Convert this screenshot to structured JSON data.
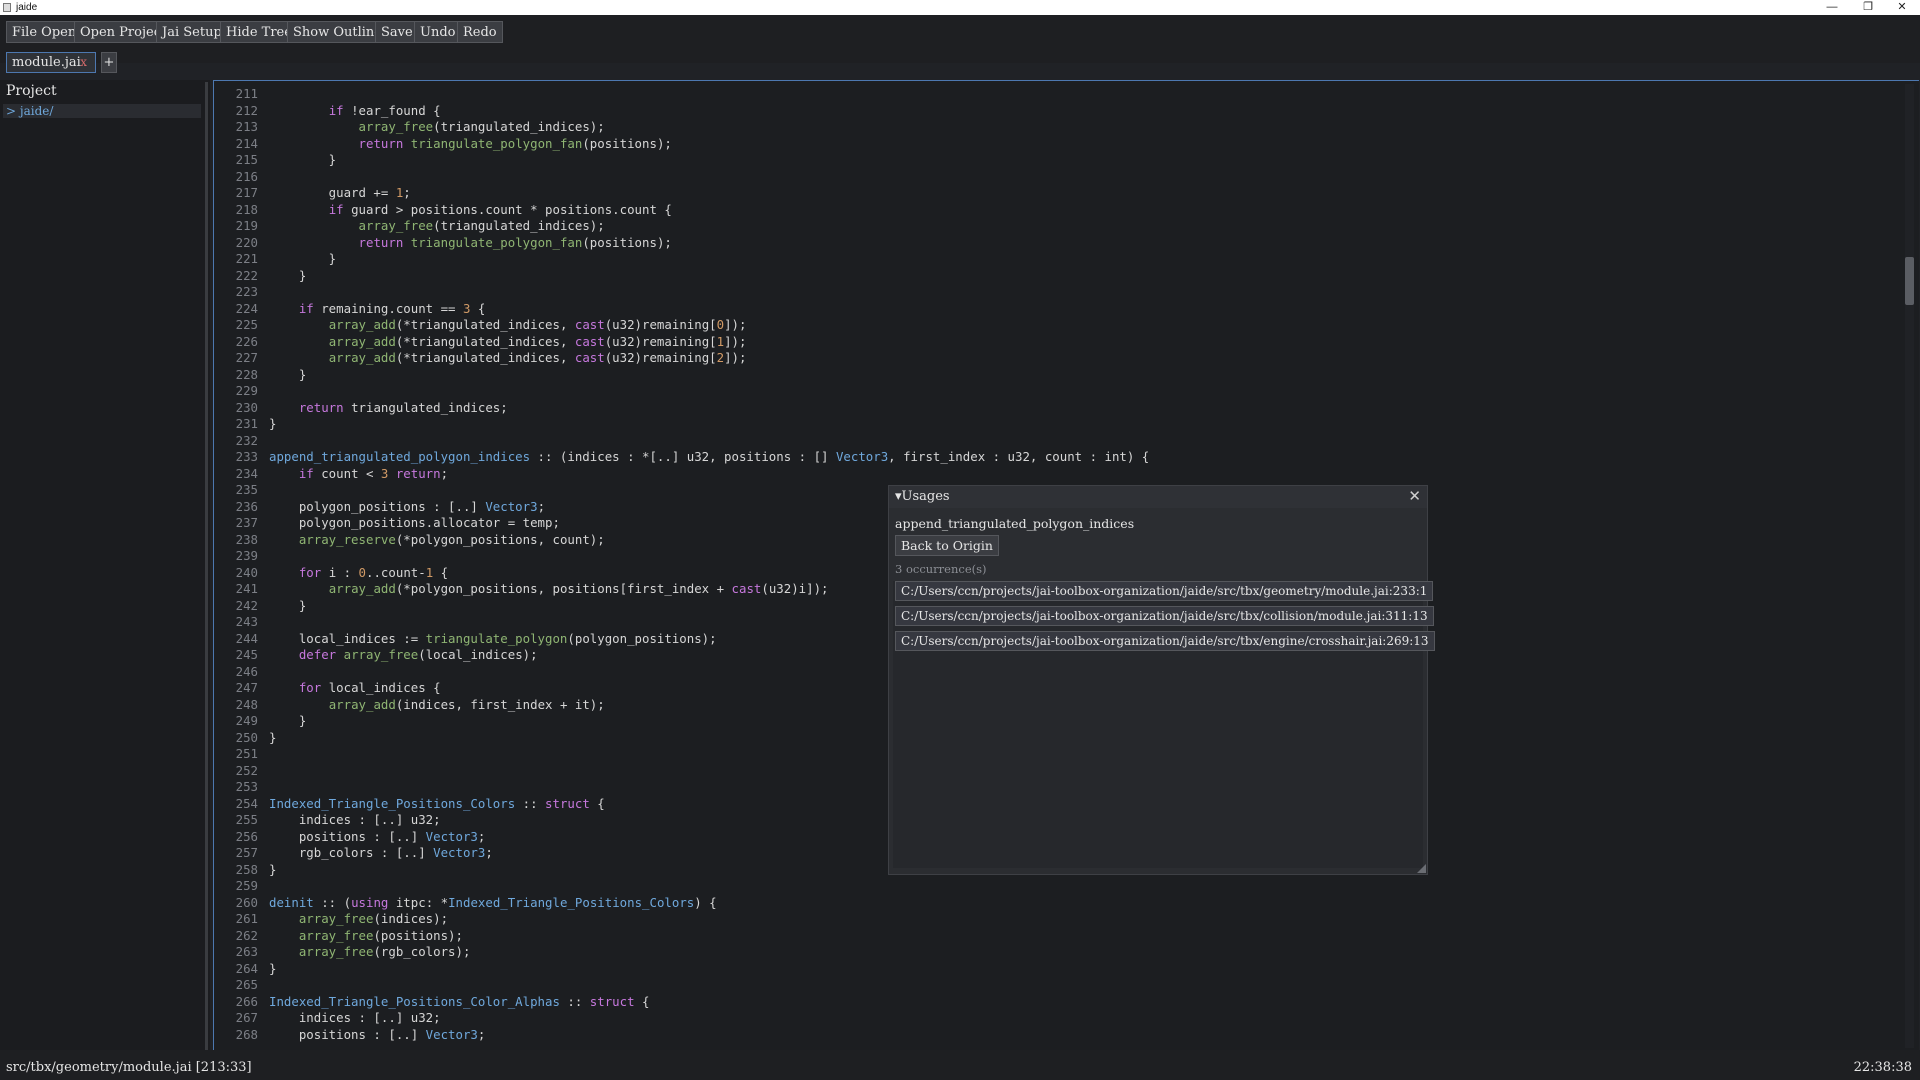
{
  "window": {
    "title": "jaide",
    "controls": {
      "minimize": "—",
      "maximize": "❐",
      "close": "✕"
    }
  },
  "toolbar": {
    "buttons": [
      "File Open",
      "Open Project",
      "Jai Setup",
      "Hide Tree",
      "Show Outline",
      "Save",
      "Undo",
      "Redo"
    ]
  },
  "tabs": {
    "items": [
      {
        "label": "module.jai",
        "close": "x"
      }
    ],
    "add_label": "+"
  },
  "sidebar": {
    "title": "Project",
    "items": [
      {
        "label": "> jaide/"
      }
    ]
  },
  "editor": {
    "lines": [
      {
        "n": "211",
        "code": ""
      },
      {
        "n": "212",
        "code": "        <k>if</k> !ear_found {"
      },
      {
        "n": "213",
        "code": "            <f>array_free</f>(triangulated_indices);"
      },
      {
        "n": "214",
        "code": "            <k>return</k> <f>triangulate_polygon_fan</f>(positions);"
      },
      {
        "n": "215",
        "code": "        }"
      },
      {
        "n": "216",
        "code": ""
      },
      {
        "n": "217",
        "code": "        guard += <n>1</n>;"
      },
      {
        "n": "218",
        "code": "        <k>if</k> guard > positions.count * positions.count {"
      },
      {
        "n": "219",
        "code": "            <f>array_free</f>(triangulated_indices);"
      },
      {
        "n": "220",
        "code": "            <k>return</k> <f>triangulate_polygon_fan</f>(positions);"
      },
      {
        "n": "221",
        "code": "        }"
      },
      {
        "n": "222",
        "code": "    }"
      },
      {
        "n": "223",
        "code": ""
      },
      {
        "n": "224",
        "code": "    <k>if</k> remaining.count == <n>3</n> {"
      },
      {
        "n": "225",
        "code": "        <f>array_add</f>(*triangulated_indices, <k>cast</k>(u32)remaining[<n>0</n>]);"
      },
      {
        "n": "226",
        "code": "        <f>array_add</f>(*triangulated_indices, <k>cast</k>(u32)remaining[<n>1</n>]);"
      },
      {
        "n": "227",
        "code": "        <f>array_add</f>(*triangulated_indices, <k>cast</k>(u32)remaining[<n>2</n>]);"
      },
      {
        "n": "228",
        "code": "    }"
      },
      {
        "n": "229",
        "code": ""
      },
      {
        "n": "230",
        "code": "    <k>return</k> triangulated_indices;"
      },
      {
        "n": "231",
        "code": "}"
      },
      {
        "n": "232",
        "code": ""
      },
      {
        "n": "233",
        "code": "<t>append_triangulated_polygon_indices</t> :: (indices : *[..] u32, positions : [] <t>Vector3</t>, first_index : u32, count : int) {"
      },
      {
        "n": "234",
        "code": "    <k>if</k> count < <n>3</n> <k>return</k>;"
      },
      {
        "n": "235",
        "code": ""
      },
      {
        "n": "236",
        "code": "    polygon_positions : [..] <t>Vector3</t>;"
      },
      {
        "n": "237",
        "code": "    polygon_positions.allocator = temp;"
      },
      {
        "n": "238",
        "code": "    <f>array_reserve</f>(*polygon_positions, count);"
      },
      {
        "n": "239",
        "code": ""
      },
      {
        "n": "240",
        "code": "    <k>for</k> i : <n>0</n>..count-<n>1</n> {"
      },
      {
        "n": "241",
        "code": "        <f>array_add</f>(*polygon_positions, positions[first_index + <k>cast</k>(u32)i]);"
      },
      {
        "n": "242",
        "code": "    }"
      },
      {
        "n": "243",
        "code": ""
      },
      {
        "n": "244",
        "code": "    local_indices := <f>triangulate_polygon</f>(polygon_positions);"
      },
      {
        "n": "245",
        "code": "    <k>defer</k> <f>array_free</f>(local_indices);"
      },
      {
        "n": "246",
        "code": ""
      },
      {
        "n": "247",
        "code": "    <k>for</k> local_indices {"
      },
      {
        "n": "248",
        "code": "        <f>array_add</f>(indices, first_index + it);"
      },
      {
        "n": "249",
        "code": "    }"
      },
      {
        "n": "250",
        "code": "}"
      },
      {
        "n": "251",
        "code": ""
      },
      {
        "n": "252",
        "code": ""
      },
      {
        "n": "253",
        "code": ""
      },
      {
        "n": "254",
        "code": "<t>Indexed_Triangle_Positions_Colors</t> :: <k>struct</k> {"
      },
      {
        "n": "255",
        "code": "    indices : [..] u32;"
      },
      {
        "n": "256",
        "code": "    positions : [..] <t>Vector3</t>;"
      },
      {
        "n": "257",
        "code": "    rgb_colors : [..] <t>Vector3</t>;"
      },
      {
        "n": "258",
        "code": "}"
      },
      {
        "n": "259",
        "code": ""
      },
      {
        "n": "260",
        "code": "<t>deinit</t> :: (<k>using</k> itpc: *<t>Indexed_Triangle_Positions_Colors</t>) {"
      },
      {
        "n": "261",
        "code": "    <f>array_free</f>(indices);"
      },
      {
        "n": "262",
        "code": "    <f>array_free</f>(positions);"
      },
      {
        "n": "263",
        "code": "    <f>array_free</f>(rgb_colors);"
      },
      {
        "n": "264",
        "code": "}"
      },
      {
        "n": "265",
        "code": ""
      },
      {
        "n": "266",
        "code": "<t>Indexed_Triangle_Positions_Color_Alphas</t> :: <k>struct</k> {"
      },
      {
        "n": "267",
        "code": "    indices : [..] u32;"
      },
      {
        "n": "268",
        "code": "    positions : [..] <t>Vector3</t>;"
      }
    ]
  },
  "usages": {
    "title": "Usages",
    "collapse_icon": "▾",
    "close": "✕",
    "function_name": "append_triangulated_polygon_indices",
    "back_label": "Back to Origin",
    "count_label": "3 occurrence(s)",
    "items": [
      "C:/Users/ccn/projects/jai-toolbox-organization/jaide/src/tbx/geometry/module.jai:233:1",
      "C:/Users/ccn/projects/jai-toolbox-organization/jaide/src/tbx/collision/module.jai:311:13",
      "C:/Users/ccn/projects/jai-toolbox-organization/jaide/src/tbx/engine/crosshair.jai:269:13"
    ]
  },
  "statusbar": {
    "path": "src/tbx/geometry/module.jai  [213:33]",
    "time": "22:38:38"
  },
  "colors": {
    "accent": "#4d78b0",
    "keyword": "#c678dd",
    "function": "#8fb573",
    "type": "#6fa8dc",
    "number": "#d19a66"
  }
}
